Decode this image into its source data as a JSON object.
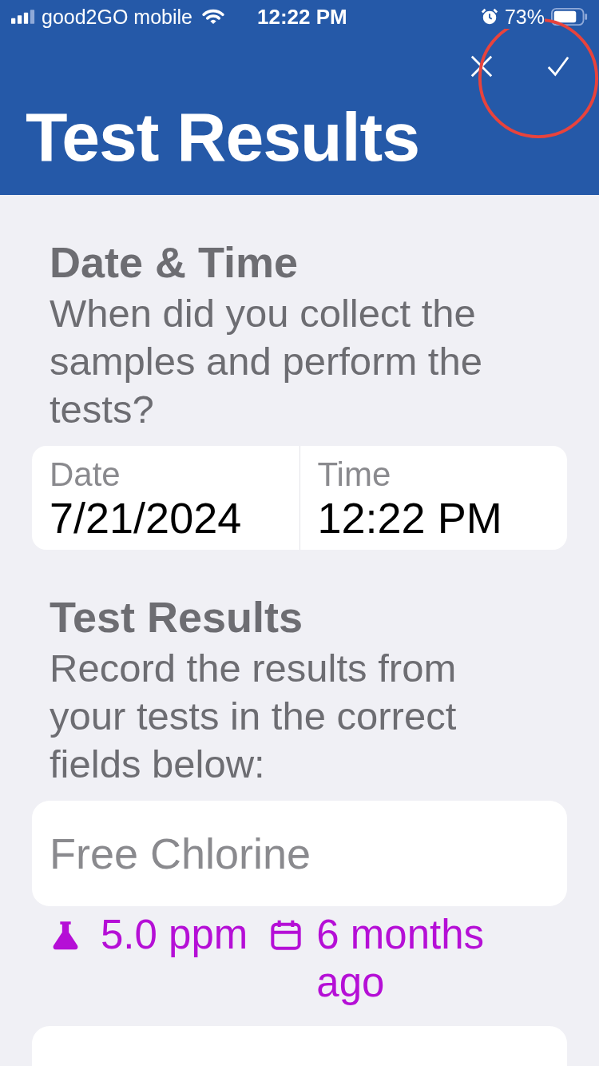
{
  "status_bar": {
    "carrier": "good2GO mobile",
    "time": "12:22 PM",
    "battery": "73%"
  },
  "header": {
    "title": "Test Results"
  },
  "sections": [
    {
      "kind": "datetime",
      "heading": "Date & Time",
      "description": "When did you collect the samples and perform the tests?",
      "fields": [
        {
          "label": "Date",
          "value": "7/21/2024"
        },
        {
          "label": "Time",
          "value": "12:22 PM"
        }
      ]
    },
    {
      "kind": "readings",
      "heading": "Test Results",
      "description": "Record the results from your tests in the correct fields below:",
      "inputs": [
        {
          "placeholder": "Free Chlorine",
          "reading": "5.0 ppm",
          "when": "6 months ago"
        }
      ],
      "more_below": true
    }
  ]
}
